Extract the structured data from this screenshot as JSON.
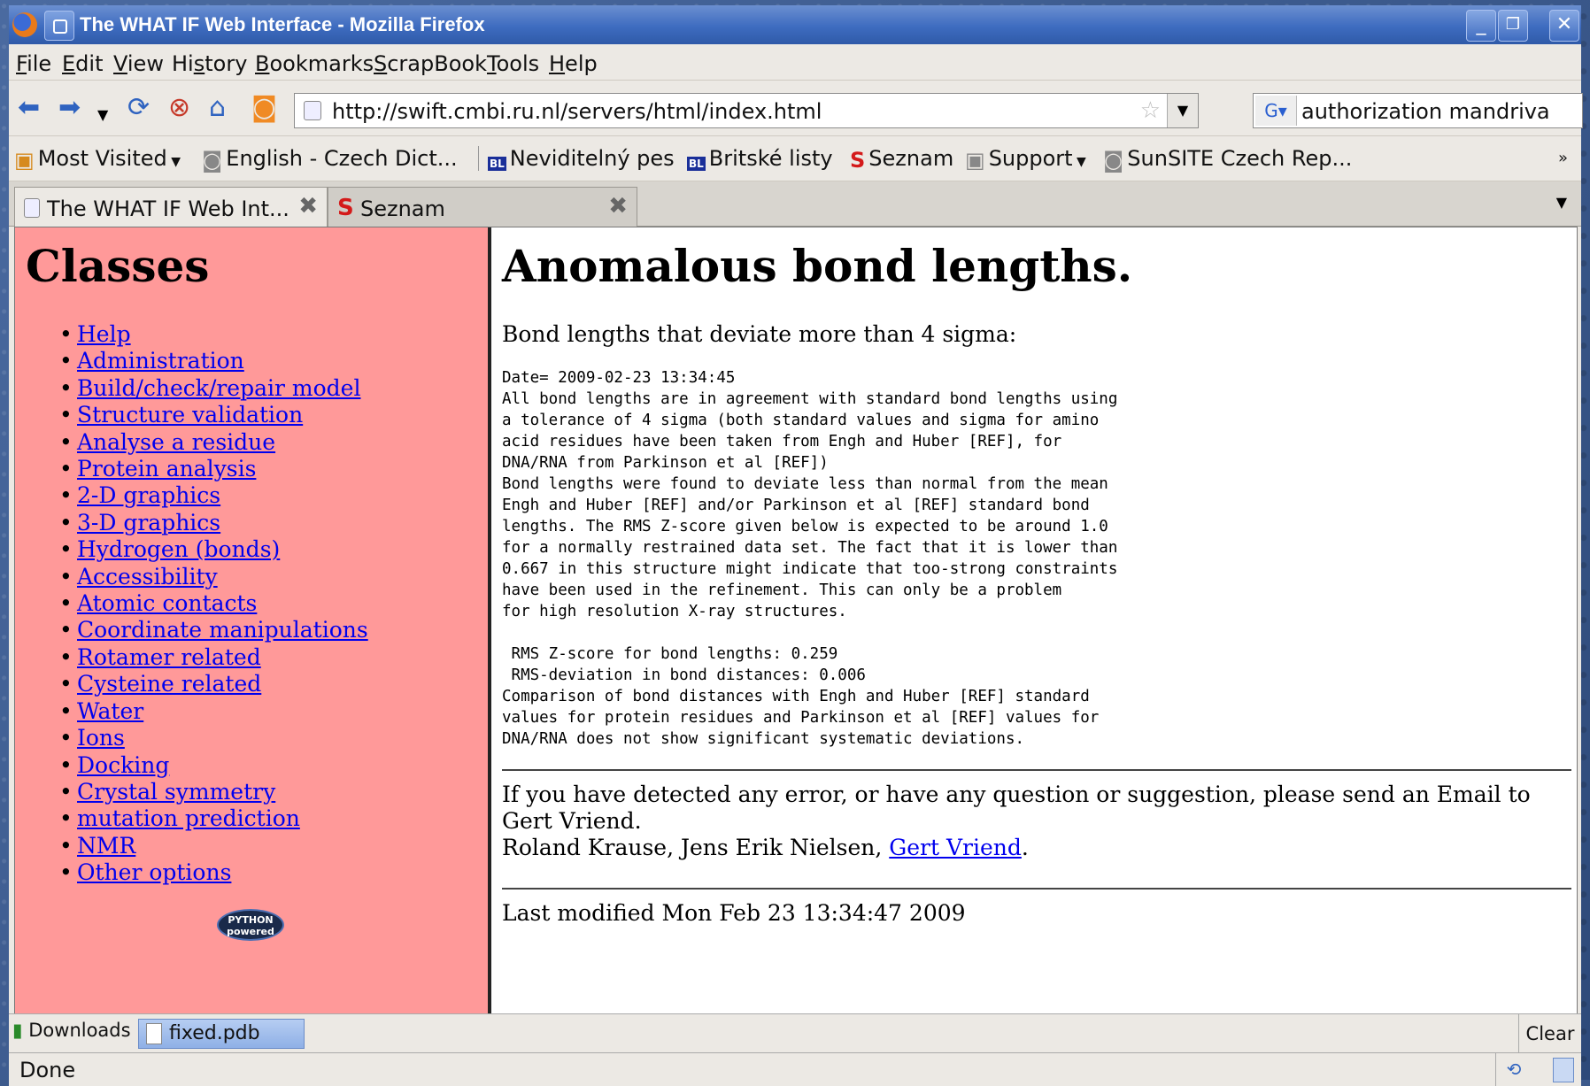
{
  "window": {
    "title": "The WHAT IF Web Interface - Mozilla Firefox"
  },
  "menu": [
    "File",
    "Edit",
    "View",
    "History",
    "Bookmarks",
    "ScrapBook",
    "Tools",
    "Help"
  ],
  "menu_access": [
    "F",
    "E",
    "V",
    "s",
    "B",
    "S",
    "T",
    "H"
  ],
  "nav": {
    "url": "http://swift.cmbi.ru.nl/servers/html/index.html",
    "search": "authorization mandriva"
  },
  "bookmarks": [
    "Most Visited",
    "English - Czech Dict...",
    "Neviditelný pes",
    "Britské listy",
    "Seznam",
    "Support",
    "SunSITE Czech Rep..."
  ],
  "tabs": [
    {
      "label": "The WHAT IF Web Int..."
    },
    {
      "label": "Seznam"
    }
  ],
  "sidebar": {
    "heading": "Classes",
    "links": [
      "Help",
      "Administration",
      "Build/check/repair model",
      "Structure validation",
      "Analyse a residue",
      "Protein analysis",
      "2-D graphics",
      "3-D graphics",
      "Hydrogen (bonds)",
      "Accessibility",
      "Atomic contacts",
      "Coordinate manipulations",
      "Rotamer related",
      "Cysteine related",
      "Water",
      "Ions",
      "Docking",
      "Crystal symmetry",
      "mutation prediction",
      "NMR",
      "Other options"
    ],
    "badge": "PYTHON powered"
  },
  "main": {
    "title": "Anomalous bond lengths.",
    "subtitle": "Bond lengths that deviate more than 4 sigma:",
    "report": "Date= 2009-02-23 13:34:45\nAll bond lengths are in agreement with standard bond lengths using\na tolerance of 4 sigma (both standard values and sigma for amino\nacid residues have been taken from Engh and Huber [REF], for\nDNA/RNA from Parkinson et al [REF])\nBond lengths were found to deviate less than normal from the mean\nEngh and Huber [REF] and/or Parkinson et al [REF] standard bond\nlengths. The RMS Z-score given below is expected to be around 1.0\nfor a normally restrained data set. The fact that it is lower than\n0.667 in this structure might indicate that too-strong constraints\nhave been used in the refinement. This can only be a problem\nfor high resolution X-ray structures.\n\n RMS Z-score for bond lengths: 0.259\n RMS-deviation in bond distances: 0.006\nComparison of bond distances with Engh and Huber [REF] standard\nvalues for protein residues and Parkinson et al [REF] values for\nDNA/RNA does not show significant systematic deviations.",
    "contact": "If you have detected any error, or have any question or suggestion, please send an Email to Gert Vriend.",
    "authors_prefix": "Roland Krause, Jens Erik Nielsen,",
    "authors_link": "Gert Vriend",
    "authors_suffix": ".",
    "modified": "Last modified Mon Feb 23 13:34:47 2009"
  },
  "downloads": {
    "label": "Downloads",
    "file": "fixed.pdb",
    "clear": "Clear"
  },
  "status": "Done"
}
